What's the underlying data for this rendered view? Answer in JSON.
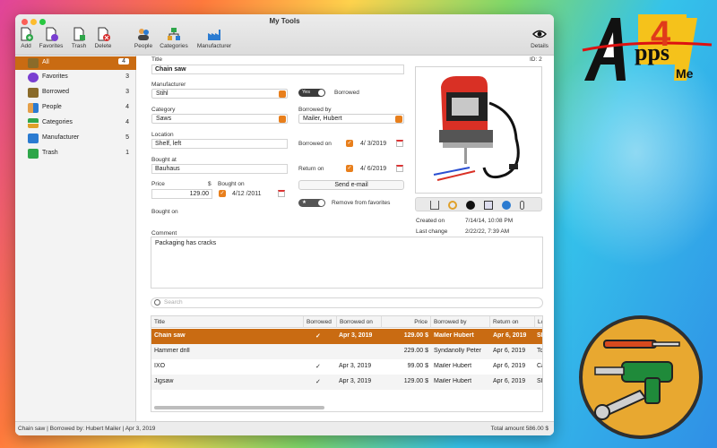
{
  "window": {
    "title": "My Tools"
  },
  "colors": {
    "accent": "#e87f1c",
    "selection": "#c96b12"
  },
  "toolbar": {
    "add": "Add",
    "favorites": "Favorites",
    "trash": "Trash",
    "delete": "Delete",
    "people": "People",
    "categories": "Categories",
    "manufacturer": "Manufacturer",
    "details": "Details"
  },
  "sidebar": {
    "items": [
      {
        "label": "All",
        "count": "4",
        "icon": "all-icon"
      },
      {
        "label": "Favorites",
        "count": "3",
        "icon": "star-icon"
      },
      {
        "label": "Borrowed",
        "count": "3",
        "icon": "borrowed-icon"
      },
      {
        "label": "People",
        "count": "4",
        "icon": "people-icon"
      },
      {
        "label": "Categories",
        "count": "4",
        "icon": "categories-icon"
      },
      {
        "label": "Manufacturer",
        "count": "5",
        "icon": "manufacturer-icon"
      },
      {
        "label": "Trash",
        "count": "1",
        "icon": "trash-icon"
      }
    ]
  },
  "detail": {
    "id": "ID: 2",
    "title_label": "Title",
    "title_value": "Chain saw",
    "manufacturer_label": "Manufacturer",
    "manufacturer_value": "Stihl",
    "category_label": "Category",
    "category_value": "Saws",
    "location_label": "Location",
    "location_value": "Shelf, left",
    "bought_at_label": "Bought at",
    "bought_at_value": "Bauhaus",
    "price_label": "Price",
    "currency": "$",
    "price_value": "129.00",
    "bought_on_label": "Bought on",
    "bought_on_value": "4/12 /2011",
    "bought_on_label2": "Bought on",
    "borrowed_toggle": "Yes",
    "borrowed_label": "Borrowed",
    "borrowed_by_label": "Borrowed by",
    "borrowed_by_value": "Mailer, Hubert",
    "borrowed_on_label": "Borrowed on",
    "borrowed_on_value": "4/ 3/2019",
    "return_on_label": "Return on",
    "return_on_value": "4/ 6/2019",
    "send_email": "Send e-mail",
    "favorite_toggle": "★",
    "favorite_label": "Remove from favorites",
    "created_on_label": "Created on",
    "created_on_value": "7/14/14, 10:08 PM",
    "last_change_label": "Last change",
    "last_change_value": "2/22/22, 7:39 AM",
    "comment_label": "Comment",
    "comment_value": "Packaging has cracks"
  },
  "search": {
    "placeholder": "Search"
  },
  "table": {
    "headers": [
      "Title",
      "Borrowed",
      "Borrowed on",
      "Price",
      "Borrowed by",
      "Return on",
      "Lo"
    ],
    "rows": [
      [
        "Chain saw",
        "✓",
        "Apr 3, 2019",
        "129.00 $",
        "Mailer Hubert",
        "Apr 6, 2019",
        "Sh"
      ],
      [
        "Hammer drill",
        "",
        "",
        "229.00 $",
        "Syndanolly Peter",
        "Apr 6, 2019",
        "To"
      ],
      [
        "IXO",
        "✓",
        "Apr 3, 2019",
        "99.00 $",
        "Mailer Hubert",
        "Apr 6, 2019",
        "Ca"
      ],
      [
        "Jigsaw",
        "✓",
        "Apr 3, 2019",
        "129.00 $",
        "Mailer Hubert",
        "Apr 6, 2019",
        "Sh"
      ]
    ]
  },
  "status": {
    "left": "Chain saw | Borrowed by: Hubert Mailer | Apr 3, 2019",
    "right": "Total amount 586.00 $"
  },
  "logo": {
    "text_a": "A",
    "text_4": "4",
    "text_pps": "pps",
    "text_me": "Me"
  }
}
